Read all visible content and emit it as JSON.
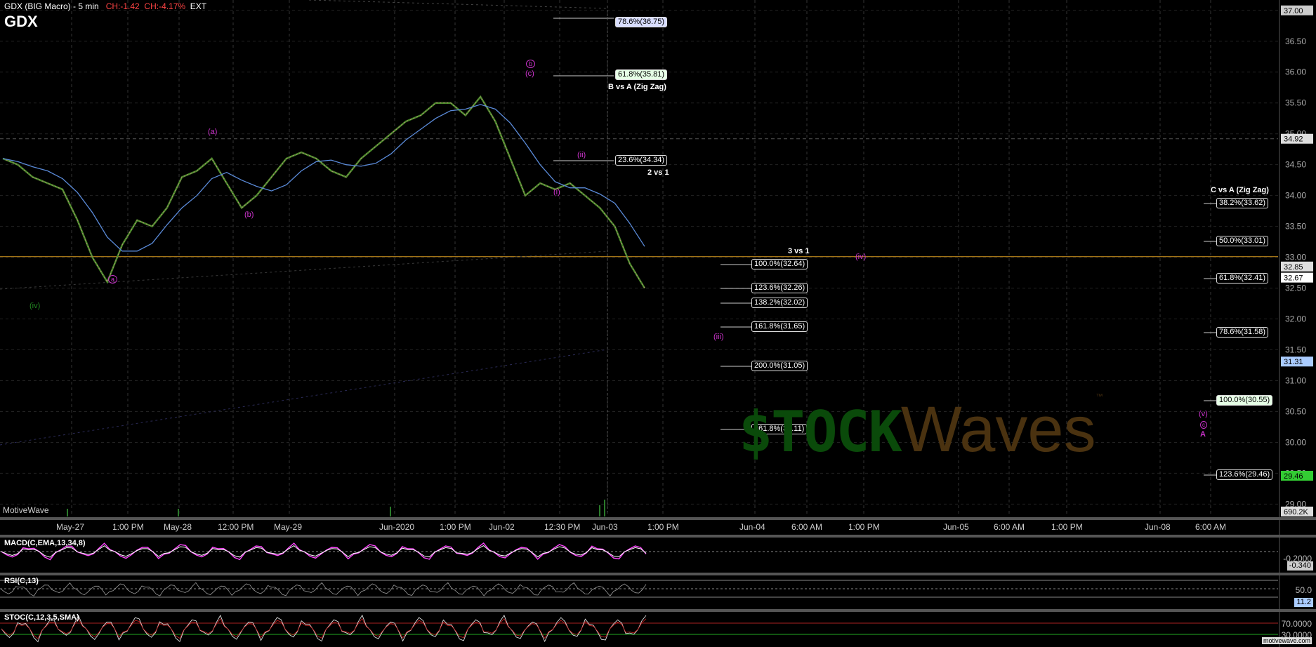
{
  "header": {
    "title": "GDX (BIG Macro) - 5 min",
    "change": "CH:-1.42",
    "change_pct": "CH:-4.17%",
    "session": "EXT"
  },
  "symbol": "GDX",
  "platform_label": "MotiveWave",
  "site_label": "motivewave.com",
  "price_axis": {
    "ticks": [
      "37.00",
      "36.50",
      "36.00",
      "35.50",
      "35.00",
      "34.50",
      "34.00",
      "33.50",
      "33.00",
      "32.50",
      "32.00",
      "31.50",
      "31.00",
      "30.50",
      "30.00",
      "29.50",
      "29.00"
    ],
    "boxes": [
      {
        "text": "37.00",
        "price": 37.0,
        "color": "#cccccc"
      },
      {
        "text": "34.92",
        "price": 34.92,
        "color": "#dddddd"
      },
      {
        "text": "32.85",
        "price": 32.85,
        "color": "#dddddd"
      },
      {
        "text": "32.67",
        "price": 32.67,
        "color": "#ffffff"
      },
      {
        "text": "31.31",
        "price": 31.31,
        "color": "#aaccff"
      },
      {
        "text": "29.46",
        "price": 29.46,
        "color": "#33cc33"
      },
      {
        "text": "690.2K",
        "price": 28.88,
        "color": "#dddddd"
      }
    ]
  },
  "time_axis": [
    "May-27",
    "1:00 PM",
    "May-28",
    "12:00 PM",
    "May-29",
    "Jun-2020",
    "1:00 PM",
    "Jun-02",
    "12:30 PM",
    "Jun-03",
    "1:00 PM",
    "Jun-04",
    "6:00 AM",
    "1:00 PM",
    "Jun-05",
    "6:00 AM",
    "1:00 PM",
    "Jun-08",
    "6:00 AM"
  ],
  "fib_labels": [
    {
      "text": "78.6%(36.75)",
      "style": "hl-blue"
    },
    {
      "text": "61.8%(35.81)",
      "style": "hl-green"
    },
    {
      "text": "23.6%(34.34)",
      "style": ""
    },
    {
      "text": "100.0%(32.64)",
      "style": ""
    },
    {
      "text": "123.6%(32.26)",
      "style": ""
    },
    {
      "text": "138.2%(32.02)",
      "style": ""
    },
    {
      "text": "161.8%(31.65)",
      "style": ""
    },
    {
      "text": "200.0%(31.05)",
      "style": ""
    },
    {
      "text": "261.8%(30.11)",
      "style": ""
    },
    {
      "text": "38.2%(33.62)",
      "style": ""
    },
    {
      "text": "50.0%(33.01)",
      "style": ""
    },
    {
      "text": "61.8%(32.41)",
      "style": ""
    },
    {
      "text": "78.6%(31.58)",
      "style": ""
    },
    {
      "text": "100.0%(30.55)",
      "style": "hl-green"
    },
    {
      "text": "123.6%(29.46)",
      "style": ""
    }
  ],
  "annotations": [
    "B vs A (Zig Zag)",
    "2 vs 1",
    "3 vs 1",
    "C vs A (Zig Zag)"
  ],
  "wave_labels": [
    "(a)",
    "(b)",
    "a",
    "(c)",
    "b",
    "(ii)",
    "(i)",
    "(iv)",
    "(iii)",
    "(v)",
    "c",
    "A",
    "(iv)"
  ],
  "watermark": {
    "left": "$TOCK",
    "right": "Waves",
    "tm": "™"
  },
  "indicators": {
    "macd": {
      "title": "MACD(C,EMA,13,34,8)",
      "values": [
        "-0.2000",
        "-0.340"
      ]
    },
    "rsi": {
      "title": "RSI(C,13)",
      "values": [
        "50.0",
        "11.2"
      ]
    },
    "stoch": {
      "title": "STOC(C,12,3,5,SMA)",
      "values": [
        "70.0000",
        "30.0000"
      ]
    }
  },
  "chart_data": {
    "type": "line",
    "title": "GDX (BIG Macro) - 5 min",
    "xlabel": "",
    "ylabel": "",
    "ylim": [
      28.8,
      37.1
    ],
    "x_ticks": [
      "May-27",
      "1:00 PM",
      "May-28",
      "12:00 PM",
      "May-29",
      "Jun-2020",
      "1:00 PM",
      "Jun-02",
      "12:30 PM",
      "Jun-03",
      "1:00 PM",
      "Jun-04",
      "6:00 AM",
      "1:00 PM",
      "Jun-05",
      "6:00 AM",
      "1:00 PM",
      "Jun-08",
      "6:00 AM"
    ],
    "series": [
      {
        "values": [
          34.6,
          34.5,
          34.3,
          34.2,
          34.1,
          33.6,
          33.0,
          32.6,
          33.2,
          33.6,
          33.5,
          33.8,
          34.3,
          34.4,
          34.6,
          34.2,
          33.8,
          34.0,
          34.3,
          34.6,
          34.7,
          34.6,
          34.4,
          34.3,
          34.6,
          34.8,
          35.0,
          35.2,
          35.3,
          35.5,
          35.5,
          35.3,
          35.6,
          35.2,
          34.6,
          34.0,
          34.2,
          34.1,
          34.2,
          34.0,
          33.8,
          33.5,
          32.9,
          32.5
        ]
      }
    ]
  }
}
